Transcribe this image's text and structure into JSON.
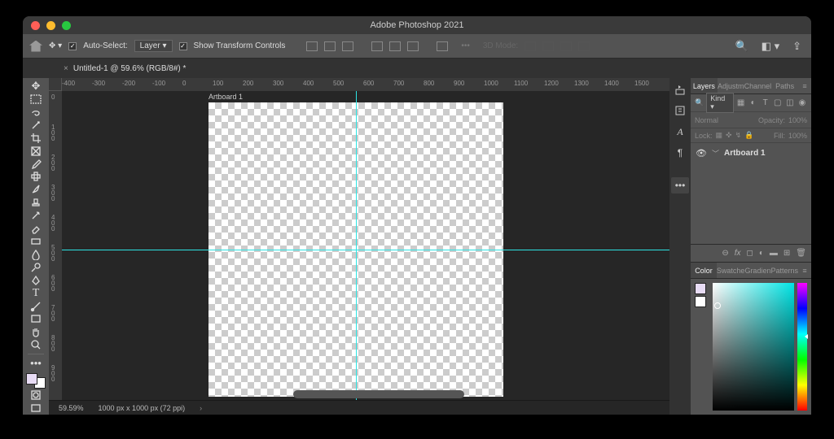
{
  "app": {
    "title": "Adobe Photoshop 2021"
  },
  "tab": {
    "close": "×",
    "label": "Untitled-1 @ 59.6% (RGB/8#) *"
  },
  "options": {
    "auto_select": "Auto-Select:",
    "auto_select_target": "Layer",
    "show_transform": "Show Transform Controls",
    "mode_3d": "3D Mode:"
  },
  "ruler_h": [
    "-400",
    "-300",
    "-200",
    "-100",
    "0",
    "100",
    "200",
    "300",
    "400",
    "500",
    "600",
    "700",
    "800",
    "900",
    "1000",
    "1100",
    "1200",
    "1300",
    "1400",
    "1500"
  ],
  "ruler_v": [
    "0",
    "100",
    "200",
    "300",
    "400",
    "500",
    "600",
    "700",
    "800",
    "900"
  ],
  "artboard": {
    "label": "Artboard 1"
  },
  "status": {
    "zoom": "59.59%",
    "dims": "1000 px x 1000 px (72 ppi)"
  },
  "panels": {
    "layers_tabs": [
      "Layers",
      "Adjustm",
      "Channel",
      "Paths"
    ],
    "kind": "Kind",
    "blend": "Normal",
    "opacity_lbl": "Opacity:",
    "opacity_val": "100%",
    "lock_lbl": "Lock:",
    "fill_lbl": "Fill:",
    "fill_val": "100%",
    "layer_name": "Artboard 1",
    "color_tabs": [
      "Color",
      "Swatche",
      "Gradien",
      "Patterns"
    ]
  }
}
